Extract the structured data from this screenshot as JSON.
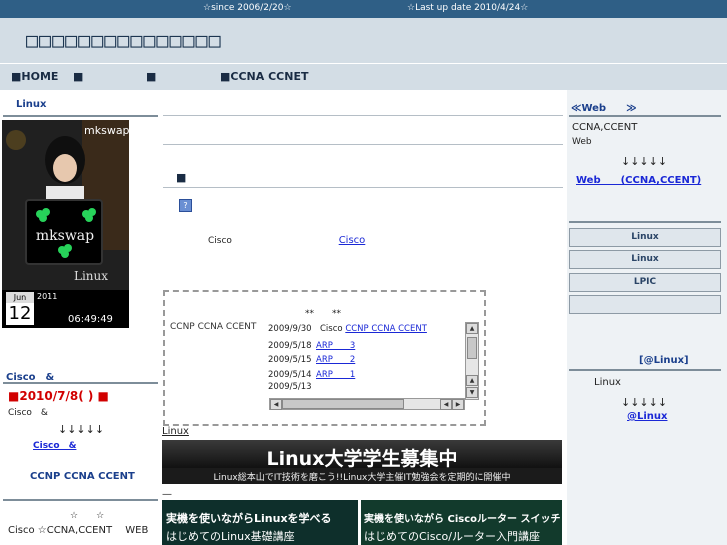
{
  "topbar": {
    "since": "☆since 2006/2/20☆",
    "last_update": "☆Last up date 2010/4/24☆"
  },
  "header": {
    "title": "□□□□□□□□□□□□□□□"
  },
  "nav": {
    "items": [
      "■HOME",
      "■",
      "■",
      "■CCNA  CCNET"
    ]
  },
  "left": {
    "linux_heading": "Linux",
    "photo": {
      "caption": "mkswap",
      "board_text": "mkswap",
      "logo_text": "Linux",
      "month": "Jun",
      "year": "2011",
      "day": "12",
      "time": "06:49:49"
    },
    "cisco_heading": "Cisco　&",
    "date_line": "■2010/7/8(  ) ■",
    "cisco_text": "Cisco　&",
    "arrows": "↓↓↓↓↓",
    "cisco_link": "Cisco　&",
    "ccnp_line": "CCNP  CCNA  CCENT",
    "stars": "☆　　☆",
    "bottom_text": "Cisco ☆CCNA,CCENT　 WEB"
  },
  "main": {
    "section_marker": "■",
    "help_icon": "?",
    "cisco_label": "Cisco",
    "cisco_link": "Cisco",
    "news": {
      "title": "**　　**",
      "side_label": "CCNP CCNA CCENT",
      "rows": [
        {
          "date": "2009/9/30",
          "prefix": "Cisco",
          "link": "CCNP CCNA CCENT"
        },
        {
          "date": "2009/5/18",
          "prefix": "",
          "link": "ARP　　3"
        },
        {
          "date": "2009/5/15",
          "prefix": "",
          "link": "ARP　　2"
        },
        {
          "date": "2009/5/14",
          "prefix": "",
          "link": "ARP　　1"
        },
        {
          "date": "2009/5/13",
          "prefix": "",
          "link": ""
        }
      ]
    },
    "linux_link": "Linux",
    "banner1": {
      "title": "Linux大学学生募集中",
      "subtitle": "Linux総本山でIT技術を磨こう!!Linux大学主催IT勉強会を定期的に開催中"
    },
    "dash": "—",
    "banner2": {
      "left_top": "実機を使いながらLinuxを学べる",
      "left_bottom": "はじめてのLinux基礎講座",
      "right_top": "実機を使いながら Ciscoルーター スイッチ 学べる",
      "right_bottom": "はじめてのCisco/ルーター入門講座"
    }
  },
  "right": {
    "web_heading": "≪Web　　≫",
    "ccna_text": "CCNA,CCENT",
    "web_text": "Web",
    "arrows": "↓↓↓↓↓",
    "web_link": "Web　　(CCNA,CCENT)",
    "buttons": [
      "Linux",
      "Linux",
      "LPIC",
      ""
    ],
    "linux_heading": "[@Linux]",
    "linux_text": "Linux",
    "arrows2": "↓↓↓↓↓",
    "linux_link": "@Linux"
  },
  "colors": {
    "topbar": "#2f5f86",
    "header": "#d3dde5",
    "link": "#1a28d6",
    "accent_red": "#d10000"
  }
}
